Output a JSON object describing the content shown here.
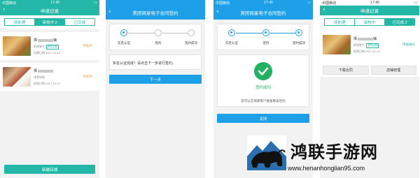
{
  "screen1": {
    "status": {
      "carrier": "中国移动",
      "time": "17:40",
      "battery": "■"
    },
    "title": "申请记录",
    "tabs": [
      "待处理",
      "审核中 2",
      "已完成"
    ],
    "active_tab": 1,
    "items": [
      {
        "name": "择",
        "suffix": "铺",
        "category": "煎饼果子",
        "tag": "资质证照",
        "date": "创建日期 2017-12-12",
        "status": "审核中"
      },
      {
        "name": "择",
        "suffix": "",
        "category": "排骨米饭",
        "tag": "",
        "date": "创建日期 2017-12-12",
        "status": "审核中"
      }
    ],
    "bottom_button": "新建店铺"
  },
  "screen2": {
    "title": "美团商家电子合同签约",
    "steps": [
      "实名认证",
      "签约",
      "签约成功"
    ],
    "message": "实名认证完成！请点击下一步进行签约。",
    "next_button": "下一步"
  },
  "screen3": {
    "status": {
      "carrier": "中国移动",
      "time": "17:40"
    },
    "title": "美团商家电子合同签约",
    "steps": [
      "实名认证",
      "签约",
      "签约成功"
    ],
    "success_title": "签约成功",
    "success_sub": "您可以在商家客户端查看该合同",
    "close_button": "关闭"
  },
  "screen4": {
    "status": {
      "carrier": "中国移动",
      "time": "17:40"
    },
    "title": "申请记录",
    "tabs": [
      "待处理",
      "审核中",
      "已完成 2"
    ],
    "active_tab": 2,
    "item": {
      "name": "择",
      "suffix": "铺",
      "category": "煎饼果子",
      "tag": "资质证照",
      "date": "创建日期 2017-12-12",
      "status": "审核通过"
    },
    "buttons": [
      "下载合同",
      "店铺管理"
    ]
  },
  "watermark": {
    "title": "鸿联手游网",
    "url": "www.henanhonglian95.com"
  }
}
